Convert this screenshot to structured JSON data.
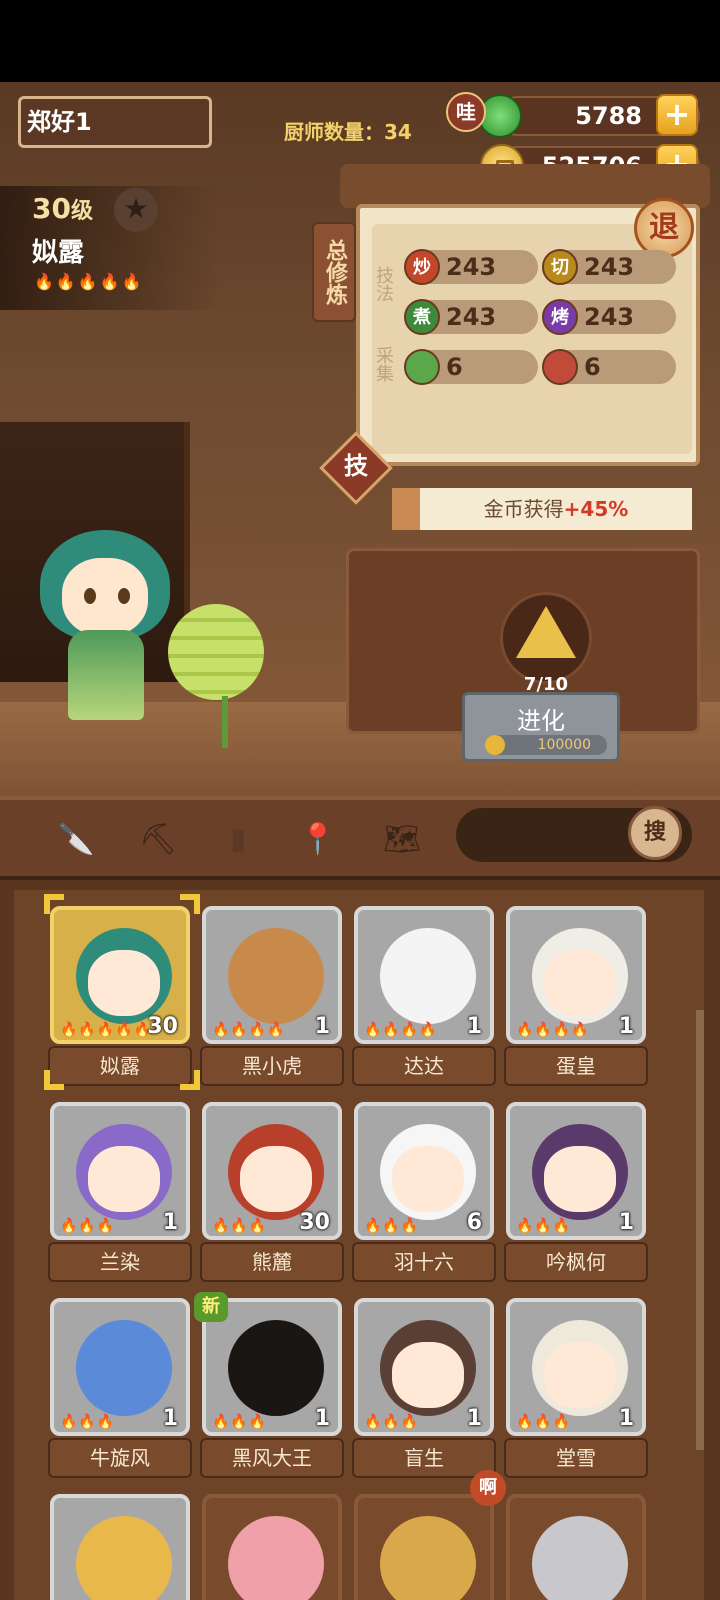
{
  "player": {
    "name": "郑好1"
  },
  "chef_count": "厨师数量：34",
  "currency": {
    "jade_badge": "哇",
    "jade_value": "5788",
    "gold_value": "525706",
    "plus": "+"
  },
  "selected_chef": {
    "level": "30",
    "level_suffix": "级",
    "name": "姒露",
    "flames": "🔥🔥🔥🔥🔥"
  },
  "panel": {
    "training_tab": "总修炼",
    "exit": "退",
    "skills_label": "技法",
    "gather_label": "采集",
    "ji_tab": "技",
    "skills": [
      {
        "icon": "炒",
        "value": "243",
        "color": "#c3482a"
      },
      {
        "icon": "切",
        "value": "243",
        "color": "#b88a1e"
      },
      {
        "icon": "煮",
        "value": "243",
        "color": "#3c8a3a"
      },
      {
        "icon": "烤",
        "value": "243",
        "color": "#7a3aa8"
      }
    ],
    "gather": [
      {
        "icon": "cabbage-icon",
        "value": "6"
      },
      {
        "icon": "meat-icon",
        "value": "6"
      }
    ],
    "bonus_text": "金币获得",
    "bonus_value": "+45%"
  },
  "evolve": {
    "progress": "7/10",
    "label": "进化",
    "cost": "100000"
  },
  "search": {
    "button": "搜"
  },
  "roster": [
    {
      "name": "姒露",
      "level": "30",
      "flames": "🔥🔥🔥🔥🔥",
      "selected": true
    },
    {
      "name": "黑小虎",
      "level": "1",
      "flames": "🔥🔥🔥🔥"
    },
    {
      "name": "达达",
      "level": "1",
      "flames": "🔥🔥🔥🔥"
    },
    {
      "name": "蛋皇",
      "level": "1",
      "flames": "🔥🔥🔥🔥"
    },
    {
      "name": "兰染",
      "level": "1",
      "flames": "🔥🔥🔥"
    },
    {
      "name": "熊麓",
      "level": "30",
      "flames": "🔥🔥🔥"
    },
    {
      "name": "羽十六",
      "level": "6",
      "flames": "🔥🔥🔥"
    },
    {
      "name": "吟枫何",
      "level": "1",
      "flames": "🔥🔥🔥"
    },
    {
      "name": "牛旋风",
      "level": "1",
      "flames": "🔥🔥🔥"
    },
    {
      "name": "黑风大王",
      "level": "1",
      "flames": "🔥🔥🔥"
    },
    {
      "name": "盲生",
      "level": "1",
      "flames": "🔥🔥🔥"
    },
    {
      "name": "堂雪",
      "level": "1",
      "flames": "🔥🔥🔥"
    }
  ],
  "badges": {
    "new": "新",
    "a": "啊"
  }
}
